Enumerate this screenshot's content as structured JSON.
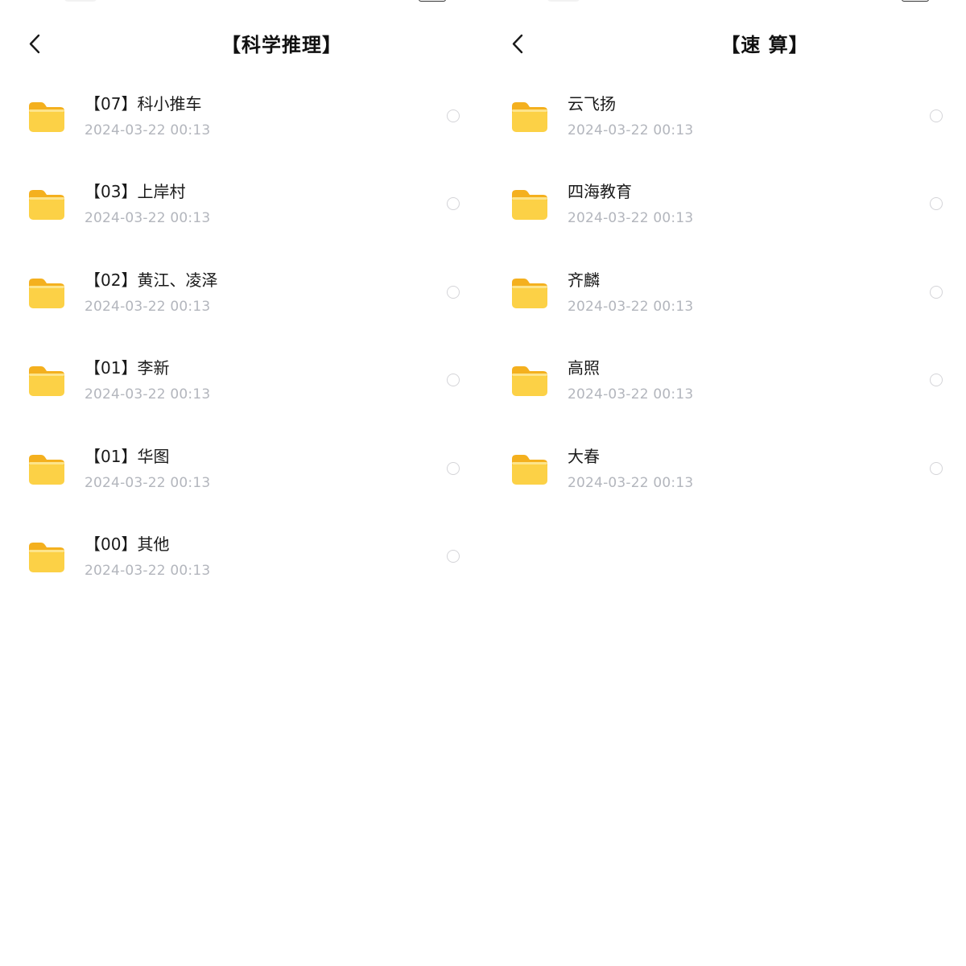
{
  "colors": {
    "background": "#ffffff",
    "title_text": "#111111",
    "name_text": "#1a1a1a",
    "date_text": "#b3b6bd",
    "radio_border": "#d4d4d8",
    "folder_yellow": "#fbcd3f"
  },
  "icons": {
    "back": "chevron-left-icon",
    "folder": "folder-icon",
    "select": "radio-unchecked-icon"
  },
  "screens": [
    {
      "title": "【科学推理】",
      "items": [
        {
          "name": "【07】科小推车",
          "date": "2024-03-22 00:13"
        },
        {
          "name": "【03】上岸村",
          "date": "2024-03-22 00:13"
        },
        {
          "name": "【02】黄江、凌泽",
          "date": "2024-03-22 00:13"
        },
        {
          "name": "【01】李新",
          "date": "2024-03-22 00:13"
        },
        {
          "name": "【01】华图",
          "date": "2024-03-22 00:13"
        },
        {
          "name": "【00】其他",
          "date": "2024-03-22 00:13"
        }
      ]
    },
    {
      "title": "【速 算】",
      "items": [
        {
          "name": "云飞扬",
          "date": "2024-03-22 00:13"
        },
        {
          "name": "四海教育",
          "date": "2024-03-22 00:13"
        },
        {
          "name": "齐麟",
          "date": "2024-03-22 00:13"
        },
        {
          "name": "高照",
          "date": "2024-03-22 00:13"
        },
        {
          "name": "大春",
          "date": "2024-03-22 00:13"
        }
      ]
    }
  ]
}
